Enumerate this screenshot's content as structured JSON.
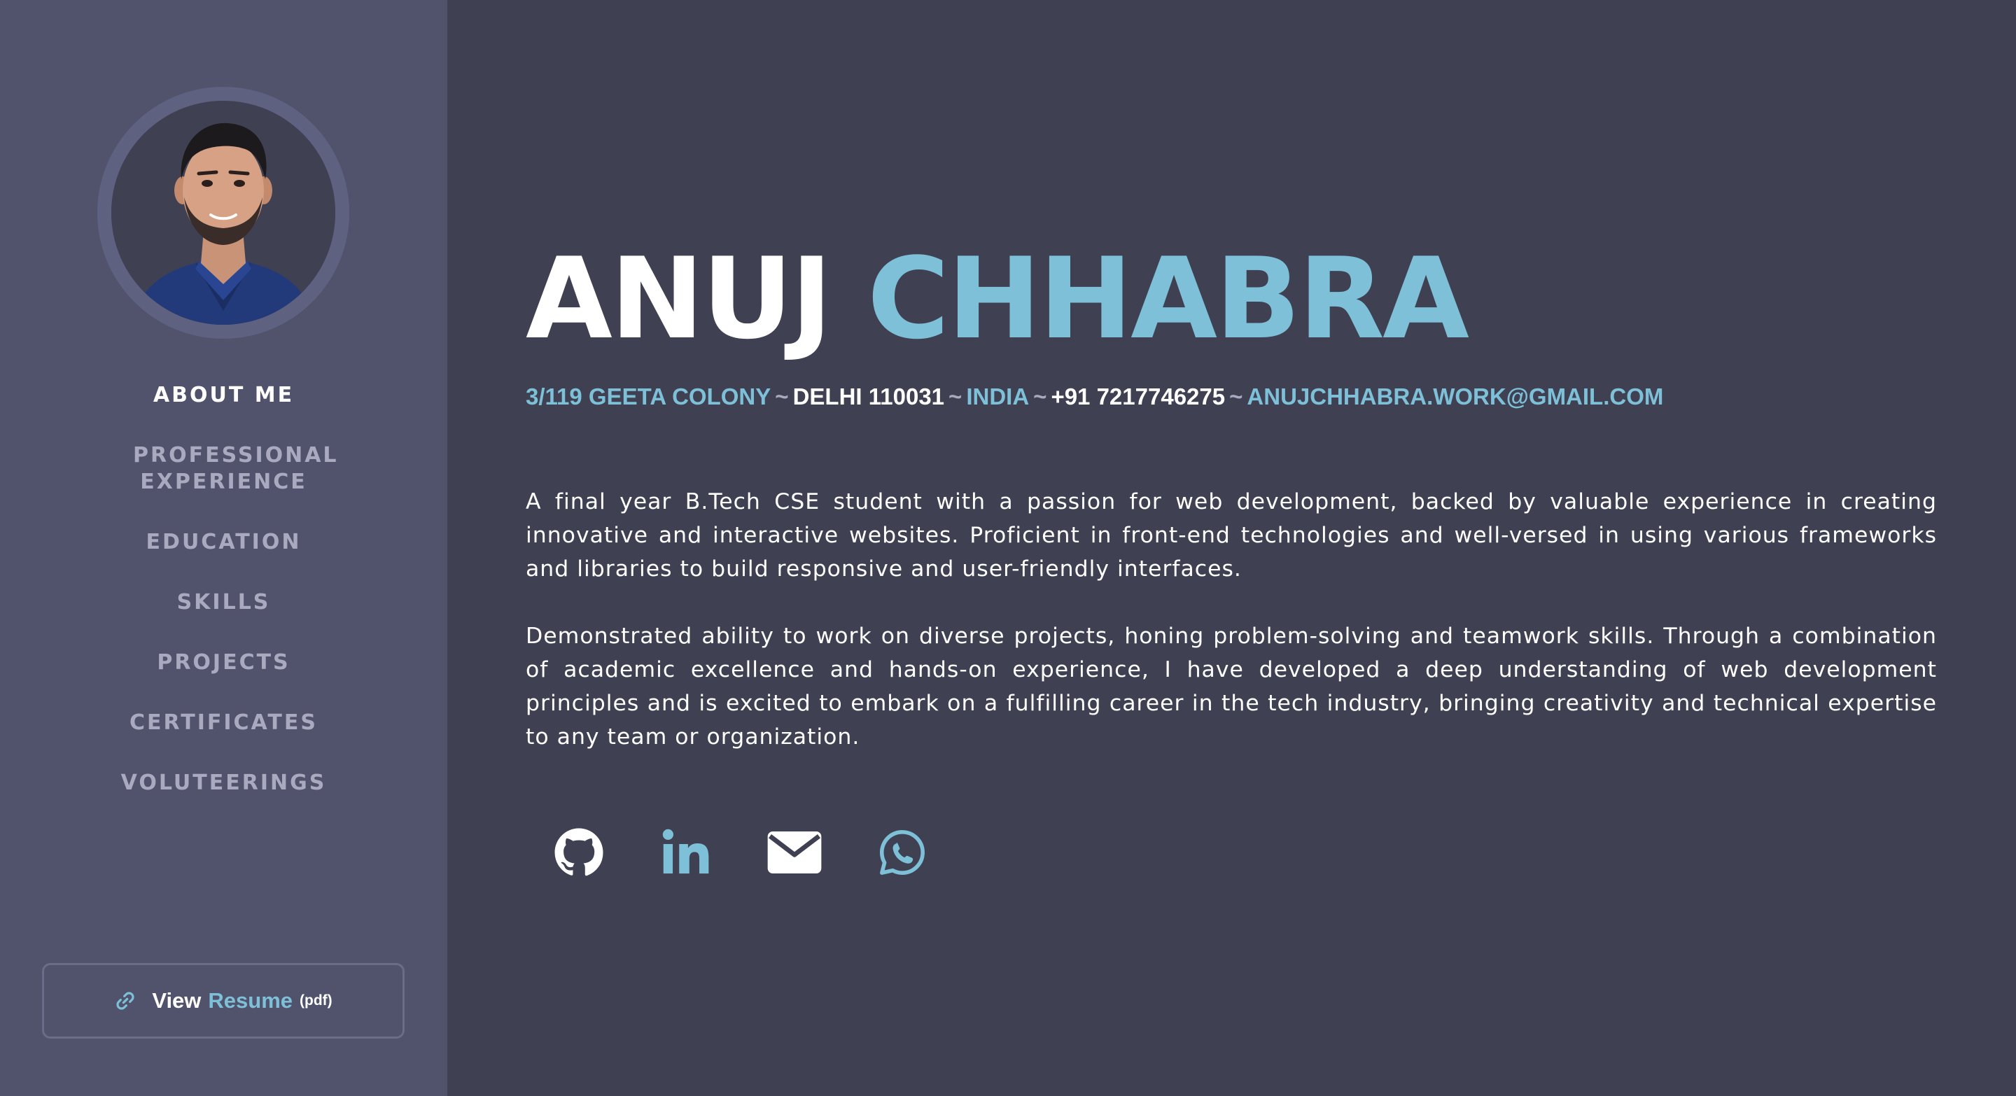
{
  "sidebar": {
    "nav": [
      {
        "label": "ABOUT ME",
        "active": true
      },
      {
        "label": "PROFESSIONAL EXPERIENCE",
        "active": false
      },
      {
        "label": "EDUCATION",
        "active": false
      },
      {
        "label": "SKILLS",
        "active": false
      },
      {
        "label": "PROJECTS",
        "active": false
      },
      {
        "label": "CERTIFICATES",
        "active": false
      },
      {
        "label": "VOLUTEERINGS",
        "active": false
      }
    ],
    "resume_button": {
      "view": "View",
      "resume": "Resume",
      "pdf": "(pdf)",
      "icon": "link-icon"
    }
  },
  "main": {
    "first_name": "ANUJ",
    "last_name": "CHHABRA",
    "contact": {
      "address": "3/119 GEETA COLONY",
      "city": "DELHI 110031",
      "country": "INDIA",
      "phone": "+91 7217746275",
      "email": "ANUJCHHABRA.WORK@GMAIL.COM",
      "separator": "~"
    },
    "bio": [
      "A final year B.Tech CSE student with a passion for web development, backed by valuable experience in creating innovative and interactive websites. Proficient in front-end technologies and well-versed in using various frameworks and libraries to build responsive and user-friendly interfaces.",
      "Demonstrated ability to work on diverse projects, honing problem-solving and teamwork skills. Through a combination of academic excellence and hands-on experience, I have developed a deep understanding of web development principles and is excited to embark on a fulfilling career in the tech industry, bringing creativity and technical expertise to any team or organization."
    ],
    "socials": [
      "github-icon",
      "linkedin-icon",
      "mail-icon",
      "whatsapp-icon"
    ]
  },
  "colors": {
    "sidebar_bg": "#51536c",
    "main_bg": "#3f4152",
    "accent": "#7dc0d8",
    "nav_inactive": "#a9aac0",
    "text": "#ffffff"
  }
}
